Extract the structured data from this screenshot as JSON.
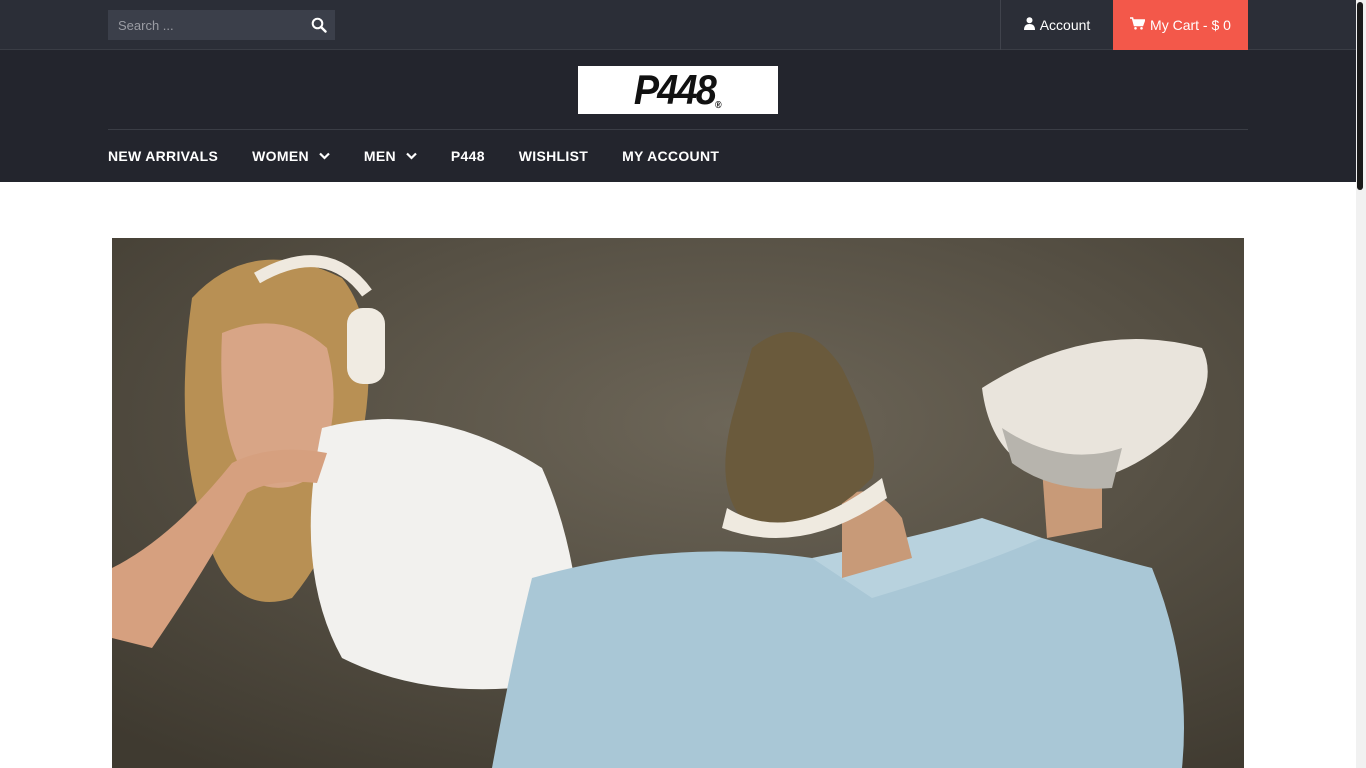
{
  "search": {
    "placeholder": "Search ...",
    "value": "",
    "icon": "search-icon"
  },
  "account": {
    "label": "Account",
    "icon": "user-icon"
  },
  "cart": {
    "label": "My Cart - $ 0",
    "icon": "cart-icon",
    "color": "#f3584a"
  },
  "logo": {
    "text": "P448",
    "reg": "®"
  },
  "nav": {
    "items": [
      {
        "label": "NEW ARRIVALS"
      },
      {
        "label": "WOMEN",
        "dropdown": true
      },
      {
        "label": "MEN",
        "dropdown": true
      },
      {
        "label": "P448"
      },
      {
        "label": "WISHLIST"
      },
      {
        "label": "MY ACCOUNT"
      }
    ]
  },
  "colors": {
    "topbar": "#2b2e37",
    "header": "#23252d",
    "accent": "#f3584a"
  }
}
